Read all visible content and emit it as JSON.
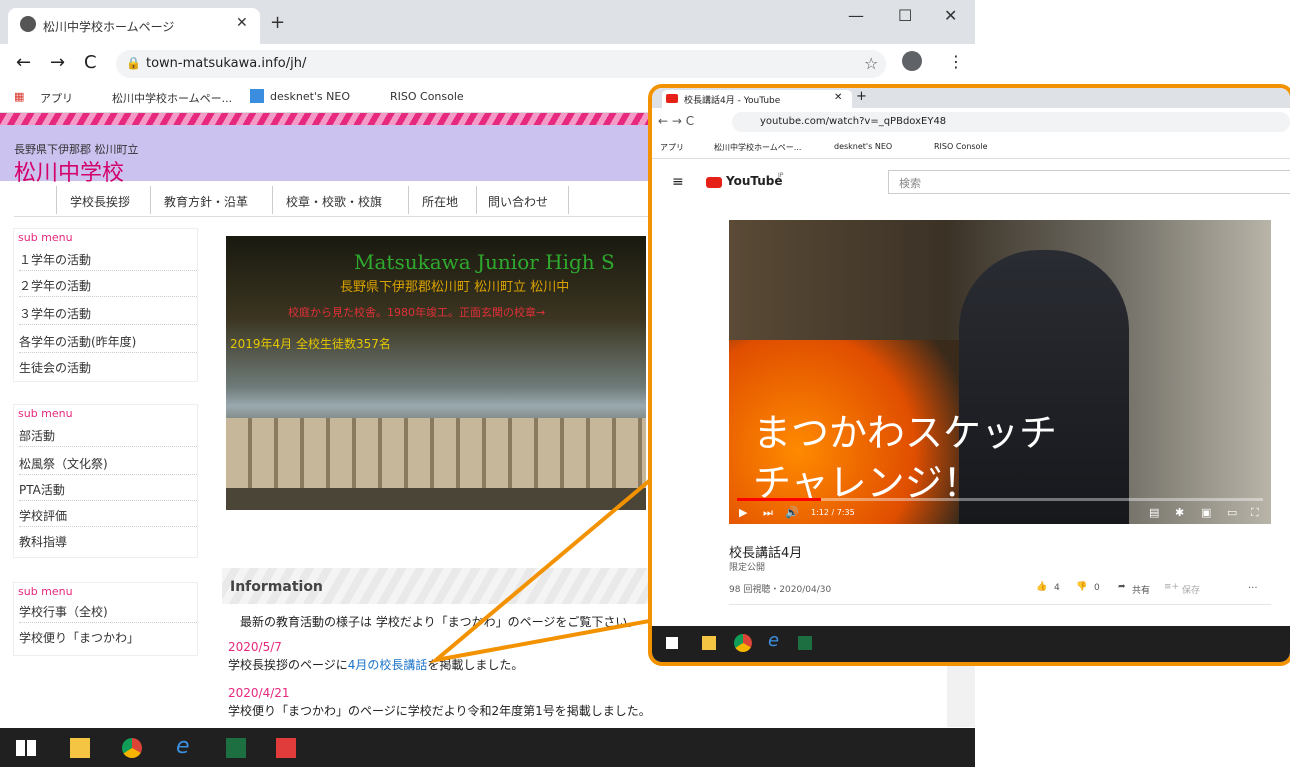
{
  "browser": {
    "tab_title": "松川中学校ホームページ",
    "url": "town-matsukawa.info/jh/",
    "bookmarks": [
      "アプリ",
      "松川中学校ホームペー...",
      "desknet's NEO",
      "RISO Console"
    ]
  },
  "site": {
    "prefecture": "長野県下伊那郡  松川町立",
    "school_name": "松川中学校",
    "nav": [
      "学校長挨拶",
      "教育方針・沿革",
      "校章・校歌・校旗",
      "所在地",
      "問い合わせ"
    ],
    "sub_menu_label": "sub menu",
    "menu1": [
      "１学年の活動",
      "２学年の活動",
      "３学年の活動",
      "各学年の活動(昨年度)",
      "生徒会の活動"
    ],
    "menu2": [
      "部活動",
      "松風祭（文化祭)",
      "PTA活動",
      "学校評価",
      "教科指導"
    ],
    "menu3": [
      "学校行事（全校)",
      "学校便り「まつかわ」"
    ],
    "hero": {
      "title_en": "Matsukawa Junior High S",
      "subtitle_jp": "長野県下伊那郡松川町 松川町立 松川中",
      "caption_red": "校庭から見た校舎。1980年竣工。正面玄関の校章→",
      "caption_yellow": "2019年4月  全校生徒数357名"
    },
    "info": {
      "title": "Information",
      "intro": "最新の教育活動の様子は 学校だより「まつかわ」のページをご覧下さい。",
      "news": [
        {
          "date": "2020/5/7",
          "text_before": "学校長挨拶のページに",
          "link": "4月の校長講話",
          "text_after": "を掲載しました。"
        },
        {
          "date": "2020/4/21",
          "text_before": "学校便り「まつかわ」のページに学校だより令和2年度第1号を掲載しました。",
          "link": "",
          "text_after": ""
        }
      ]
    }
  },
  "youtube": {
    "tab_title": "校長講話4月 - YouTube",
    "url": "youtube.com/watch?v=_qPBdoxEY48",
    "bookmarks": [
      "アプリ",
      "松川中学校ホームペー...",
      "desknet's NEO",
      "RISO Console"
    ],
    "logo": "YouTube",
    "logo_sup": "JP",
    "search_placeholder": "検索",
    "overlay_line1": "まつかわスケッチ",
    "overlay_line2": "チャレンジ！",
    "time": "1:12 / 7:35",
    "progress": 0.16,
    "video_title": "校長講話4月",
    "visibility": "限定公開",
    "views_date": "98 回視聴・2020/04/30",
    "likes": "4",
    "dislikes": "0",
    "share": "共有",
    "save": "保存",
    "more": "..."
  },
  "colors": {
    "accent_orange": "#f39200",
    "pink": "#e6287e",
    "header_lavender": "#ccc2f0",
    "link": "#1a73c9"
  }
}
